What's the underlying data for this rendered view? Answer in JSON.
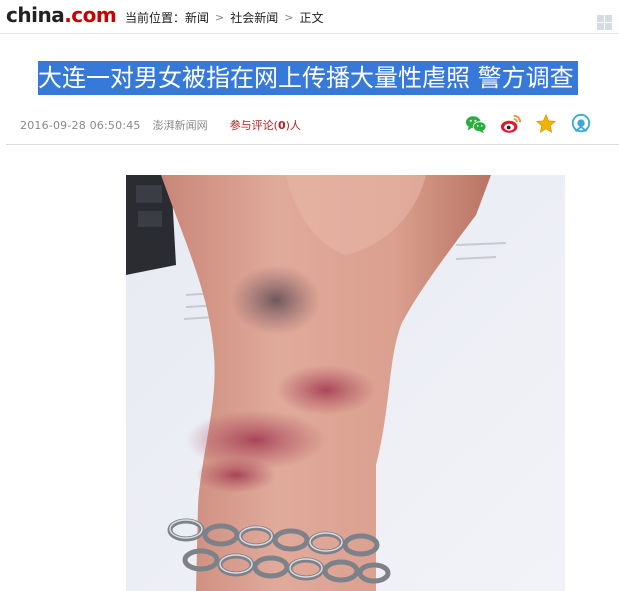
{
  "logo": {
    "part1": "china",
    "part2": ".com"
  },
  "breadcrumb": {
    "label": "当前位置：",
    "items": [
      "新闻",
      "社会新闻",
      "正文"
    ],
    "separator": ">"
  },
  "article": {
    "title": "大连一对男女被指在网上传播大量性虐照 警方调查",
    "date": "2016-09-28 06:50:45",
    "source": "澎湃新闻网",
    "comment_prefix": "参与评论",
    "comment_open": "(",
    "comment_count": "0",
    "comment_close": ")",
    "comment_suffix": "人"
  },
  "share": {
    "icons": [
      "wechat-icon",
      "weibo-icon",
      "favorite-star-icon",
      "qzone-icon"
    ]
  },
  "colors": {
    "title_highlight": "#3779d9",
    "logo_red": "#cc0000",
    "comment_red": "#b32020",
    "wechat_green": "#2aae3c",
    "weibo_red": "#e6162d",
    "star_gold": "#f0b400",
    "qzone_blue": "#3aa9d6"
  }
}
